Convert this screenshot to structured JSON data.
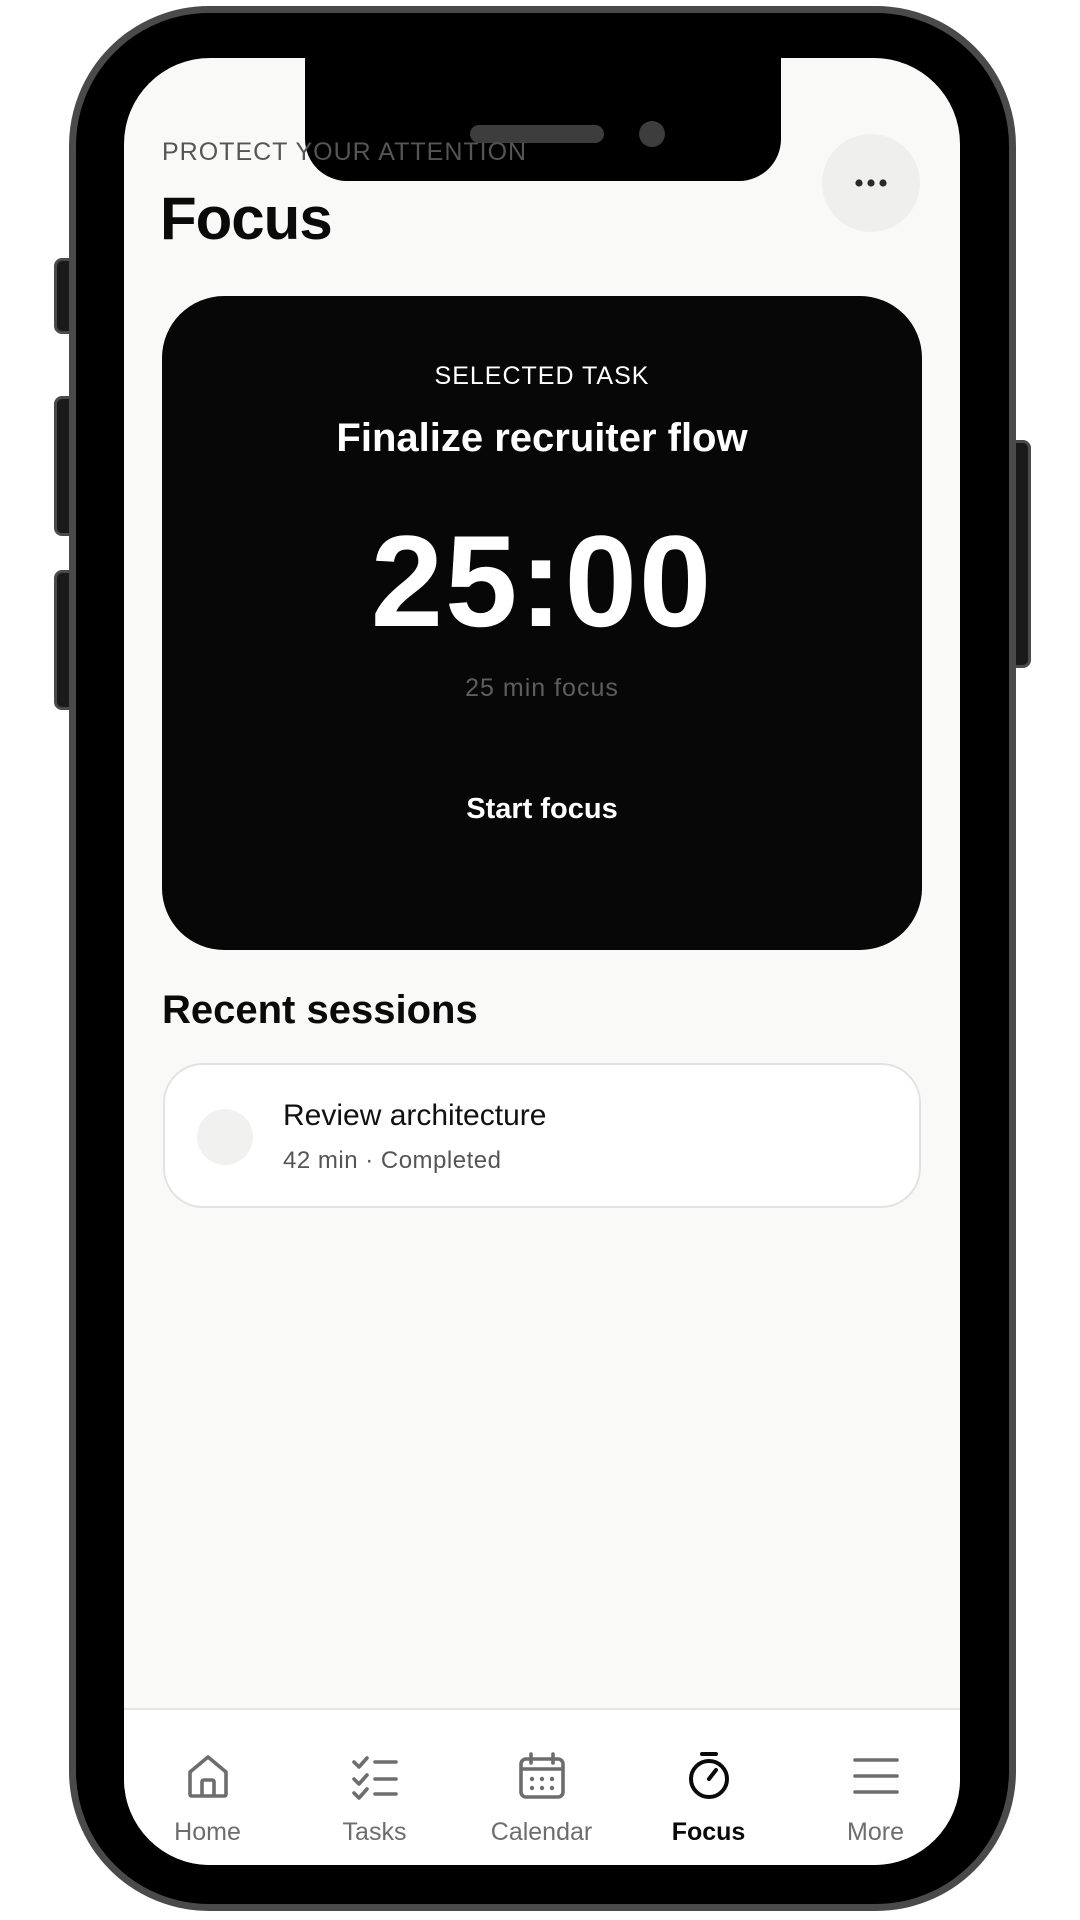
{
  "header": {
    "eyebrow": "PROTECT YOUR ATTENTION",
    "title": "Focus"
  },
  "focus_card": {
    "eyebrow": "SELECTED TASK",
    "task": "Finalize recruiter flow",
    "timer": "25:00",
    "duration": "25 min focus",
    "start_label": "Start focus"
  },
  "recent": {
    "title": "Recent sessions",
    "items": [
      {
        "title": "Review architecture",
        "meta": "42 min · Completed"
      }
    ]
  },
  "tabs": [
    {
      "label": "Home",
      "icon": "home-icon",
      "active": false
    },
    {
      "label": "Tasks",
      "icon": "tasks-icon",
      "active": false
    },
    {
      "label": "Calendar",
      "icon": "calendar-icon",
      "active": false
    },
    {
      "label": "Focus",
      "icon": "stopwatch-icon",
      "active": true
    },
    {
      "label": "More",
      "icon": "menu-icon",
      "active": false
    }
  ],
  "colors": {
    "screen_background": "#f9f9f8",
    "card_background": "#070707",
    "active_tab": "#0a0a0a",
    "inactive_tab": "#6d6d6d"
  }
}
